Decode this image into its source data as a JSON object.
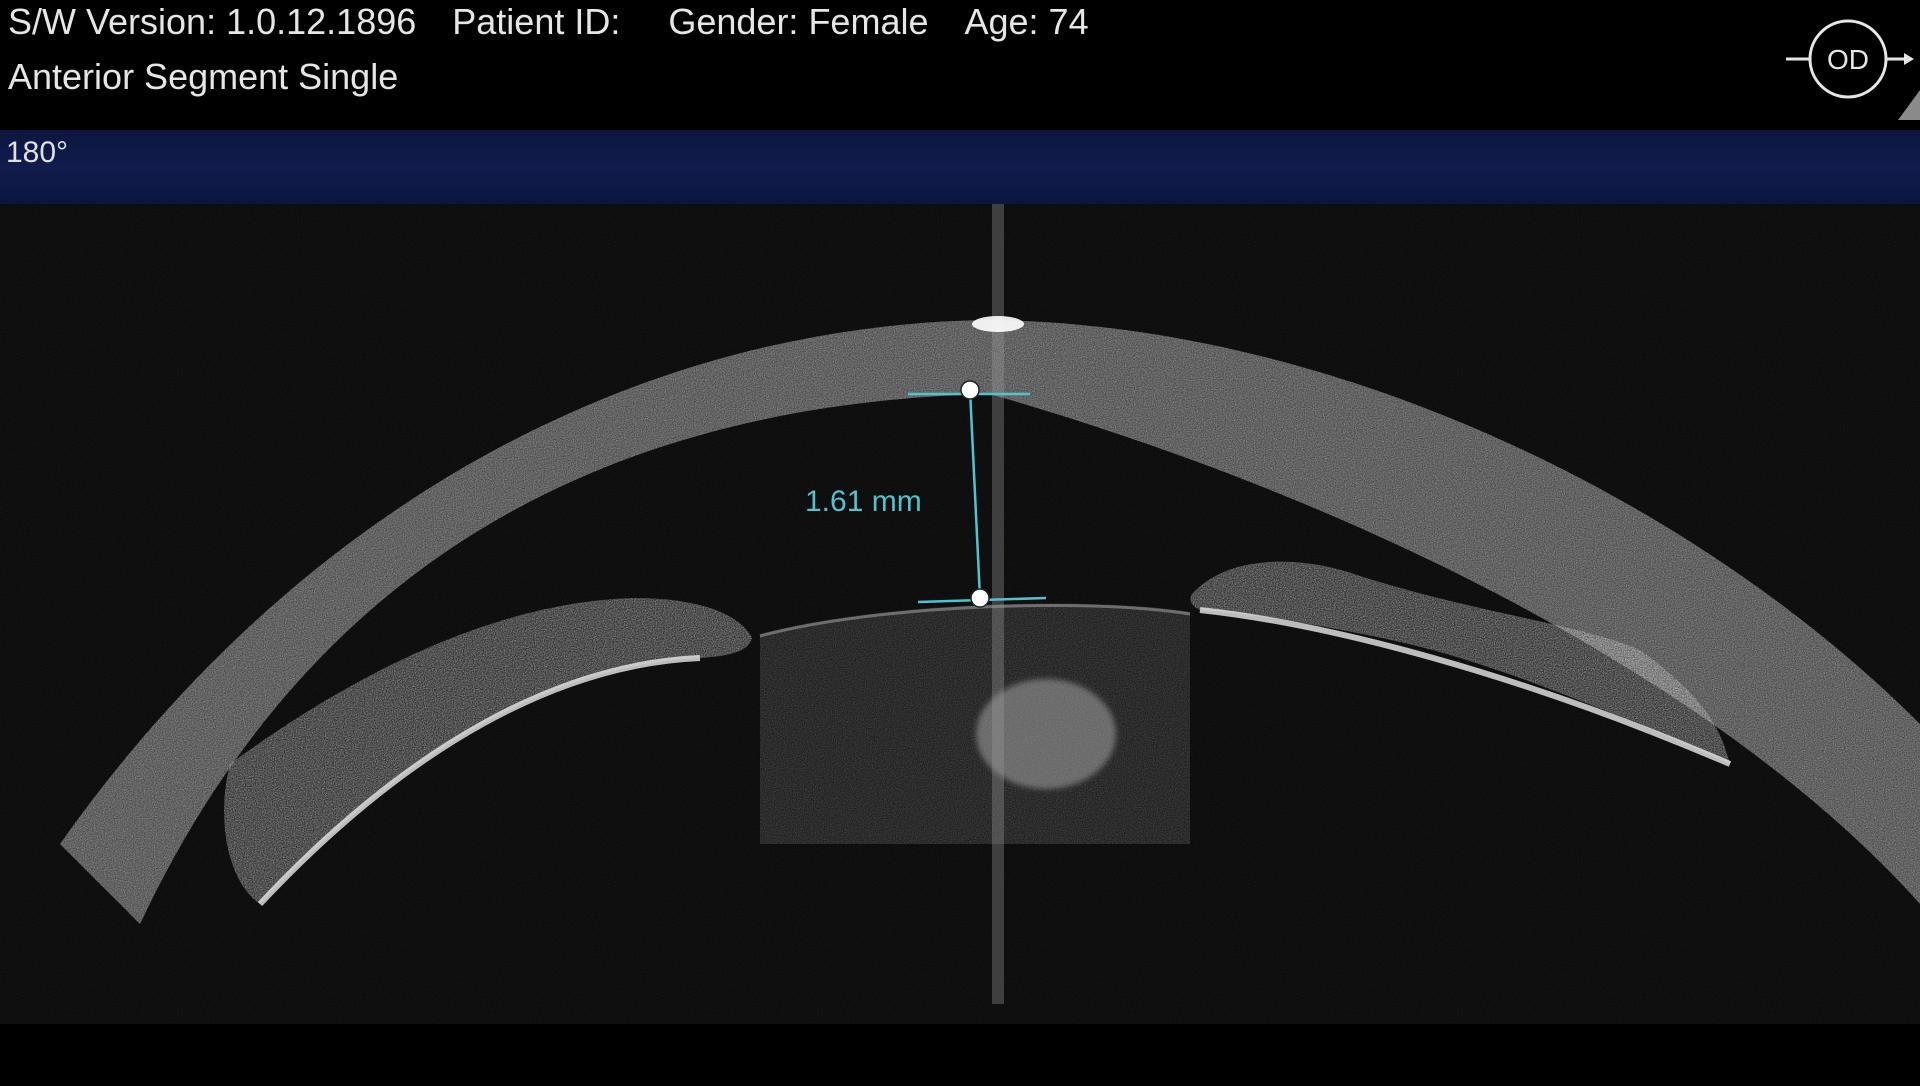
{
  "header": {
    "sw_version": "S/W Version: 1.0.12.1896",
    "patient_id": "Patient ID:",
    "gender": "Gender: Female",
    "age": "Age: 74",
    "scan_type": "Anterior Segment Single"
  },
  "eye": {
    "label": "OD"
  },
  "scan": {
    "angle": "180°"
  },
  "measurement": {
    "value": "1.61 mm",
    "color": "#4fc3cf"
  },
  "icons": {
    "eye_indicator": "od-eye-indicator-icon"
  }
}
